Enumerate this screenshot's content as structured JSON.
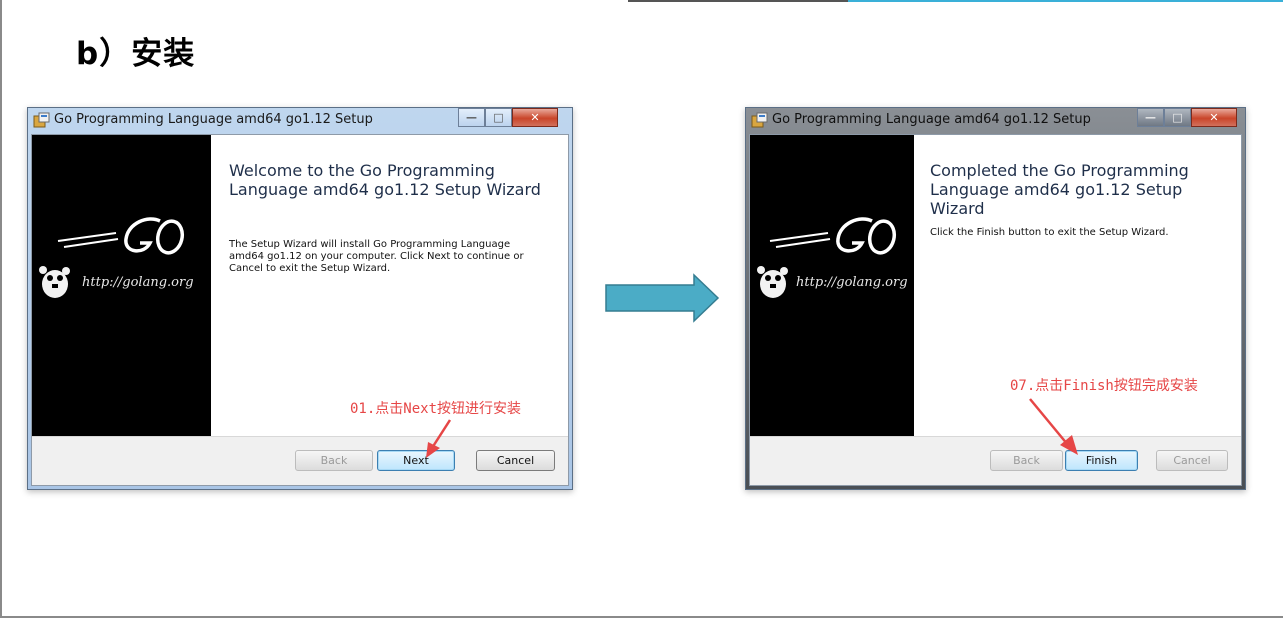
{
  "slide": {
    "title": "b）安装"
  },
  "left_window": {
    "title": "Go Programming Language amd64 go1.12 Setup",
    "heading": "Welcome to the Go Programming Language amd64 go1.12 Setup Wizard",
    "body": "The Setup Wizard will install Go Programming Language amd64 go1.12 on your computer. Click Next to continue or Cancel to exit the Setup Wizard.",
    "banner_url": "http://golang.org",
    "buttons": {
      "back": "Back",
      "next": "Next",
      "cancel": "Cancel"
    },
    "annotation": "01.点击Next按钮进行安装",
    "controls": {
      "minimize": "—",
      "maximize": "□",
      "close": "✕"
    }
  },
  "right_window": {
    "title": "Go Programming Language amd64 go1.12 Setup",
    "heading": "Completed the Go Programming Language amd64 go1.12 Setup Wizard",
    "body": "Click the Finish button to exit the Setup Wizard.",
    "banner_url": "http://golang.org",
    "buttons": {
      "back": "Back",
      "finish": "Finish",
      "cancel": "Cancel"
    },
    "annotation": "07.点击Finish按钮完成安装",
    "controls": {
      "minimize": "—",
      "maximize": "□",
      "close": "✕"
    }
  },
  "colors": {
    "annotation": "#e64646",
    "flow_arrow_fill": "#4bacc6",
    "flow_arrow_stroke": "#357d91",
    "accent_line": "#3ab0d8"
  }
}
